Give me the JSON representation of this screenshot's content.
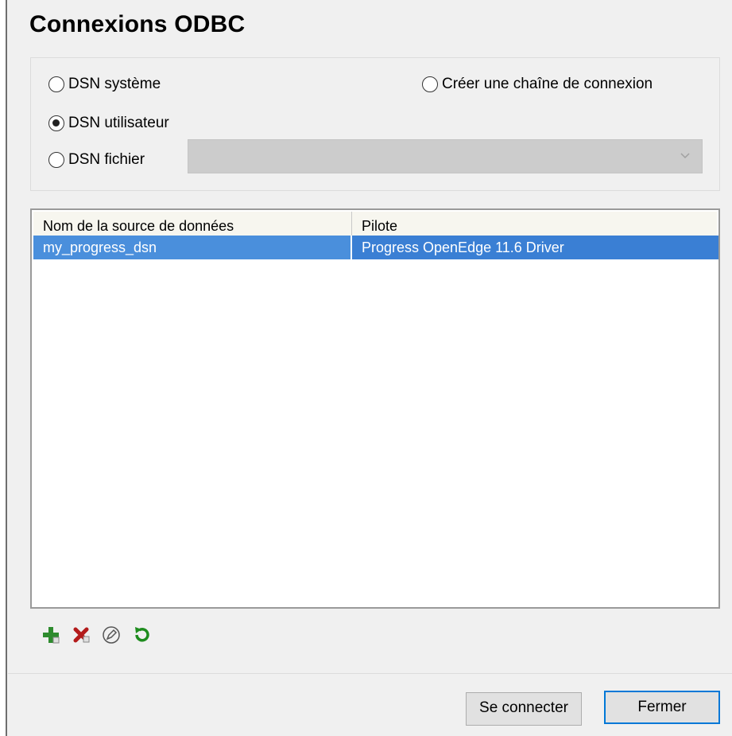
{
  "dialog": {
    "title": "Connexions ODBC"
  },
  "source_type": {
    "options": [
      {
        "label": "DSN système",
        "selected": false
      },
      {
        "label": "DSN utilisateur",
        "selected": true
      },
      {
        "label": "DSN fichier",
        "selected": false
      },
      {
        "label": "Créer une chaîne de connexion",
        "selected": false
      }
    ],
    "file_dsn_combo": {
      "value": "",
      "enabled": false
    }
  },
  "dsn_table": {
    "columns": [
      "Nom de la source de données",
      "Pilote"
    ],
    "rows": [
      {
        "name": "my_progress_dsn",
        "driver": "Progress OpenEdge 11.6 Driver",
        "selected": true
      }
    ]
  },
  "toolbar": {
    "icons": [
      "add-icon",
      "delete-icon",
      "edit-icon",
      "refresh-icon"
    ]
  },
  "buttons": {
    "connect_label": "Se connecter",
    "close_label": "Fermer"
  },
  "colors": {
    "selection": "#3a7fd4",
    "default_button_border": "#0078d7",
    "add_icon": "#2e8b2e",
    "delete_icon": "#b31b1b"
  }
}
